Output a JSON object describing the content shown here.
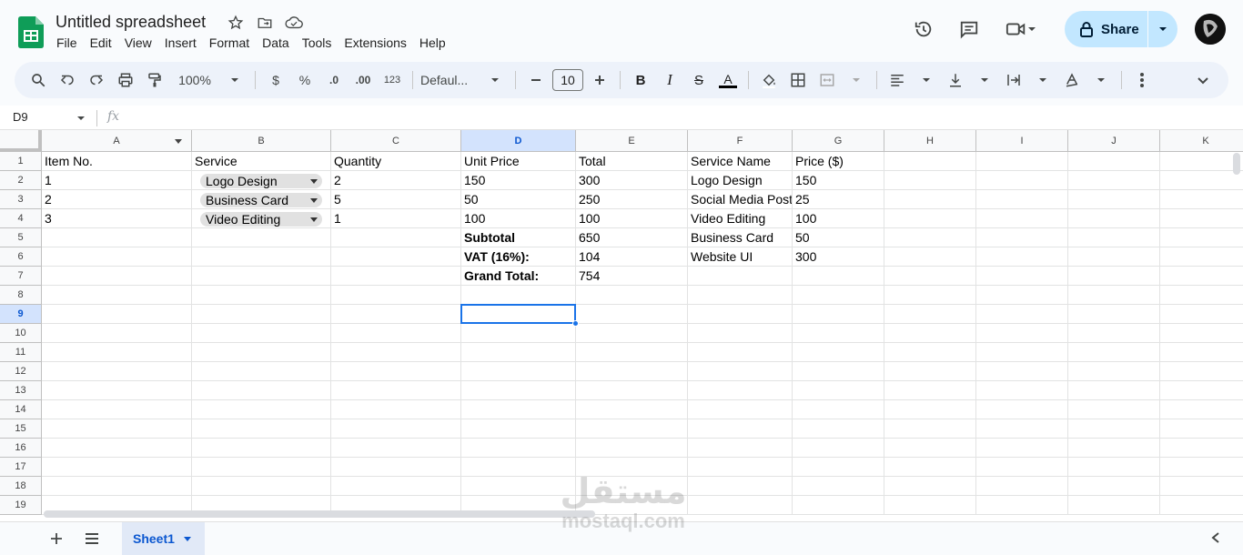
{
  "app": {
    "title": "Untitled spreadsheet",
    "menu": [
      "File",
      "Edit",
      "View",
      "Insert",
      "Format",
      "Data",
      "Tools",
      "Extensions",
      "Help"
    ],
    "share_label": "Share"
  },
  "toolbar": {
    "zoom": "100%",
    "currency": "$",
    "percent": "%",
    "dec_decrease": ".0",
    "dec_increase": ".00",
    "number_format": "123",
    "font": "Defaul...",
    "font_size": "10",
    "bold": "B",
    "italic": "I",
    "strike": "S",
    "text_color": "A"
  },
  "formula_bar": {
    "name_box": "D9",
    "fx": "fx",
    "value": ""
  },
  "columns": [
    "A",
    "B",
    "C",
    "D",
    "E",
    "F",
    "G",
    "H",
    "I",
    "J",
    "K"
  ],
  "rows": [
    "1",
    "2",
    "3",
    "4",
    "5",
    "6",
    "7",
    "8",
    "9",
    "10",
    "11",
    "12",
    "13",
    "14",
    "15",
    "16",
    "17",
    "18",
    "19"
  ],
  "cells": {
    "A1": "Item No.",
    "B1": "Service",
    "C1": "Quantity",
    "D1": "Unit Price",
    "E1": "Total",
    "F1": "Service Name",
    "G1": "Price ($)",
    "A2": "1",
    "B2": "Logo Design",
    "C2": "2",
    "D2": "150",
    "E2": "300",
    "F2": "Logo Design",
    "G2": "150",
    "A3": "2",
    "B3": "Business Card",
    "C3": "5",
    "D3": "50",
    "E3": "250",
    "F3": "Social Media Post",
    "G3": "25",
    "A4": "3",
    "B4": "Video Editing",
    "C4": "1",
    "D4": "100",
    "E4": "100",
    "F4": "Video Editing",
    "G4": "100",
    "D5": "Subtotal",
    "E5": "650",
    "F5": "Business Card",
    "G5": "50",
    "D6": "VAT (16%):",
    "E6": "104",
    "F6": "Website UI",
    "G6": "300",
    "D7": "Grand Total:",
    "E7": "754"
  },
  "selected_cell": "D9",
  "sheet_tab": "Sheet1",
  "watermark": {
    "arabic": "مستقل",
    "latin": "mostaql.com"
  },
  "colors": {
    "accent": "#1a73e8",
    "share_bg": "#c2e7ff",
    "logo_green": "#0f9d58"
  }
}
